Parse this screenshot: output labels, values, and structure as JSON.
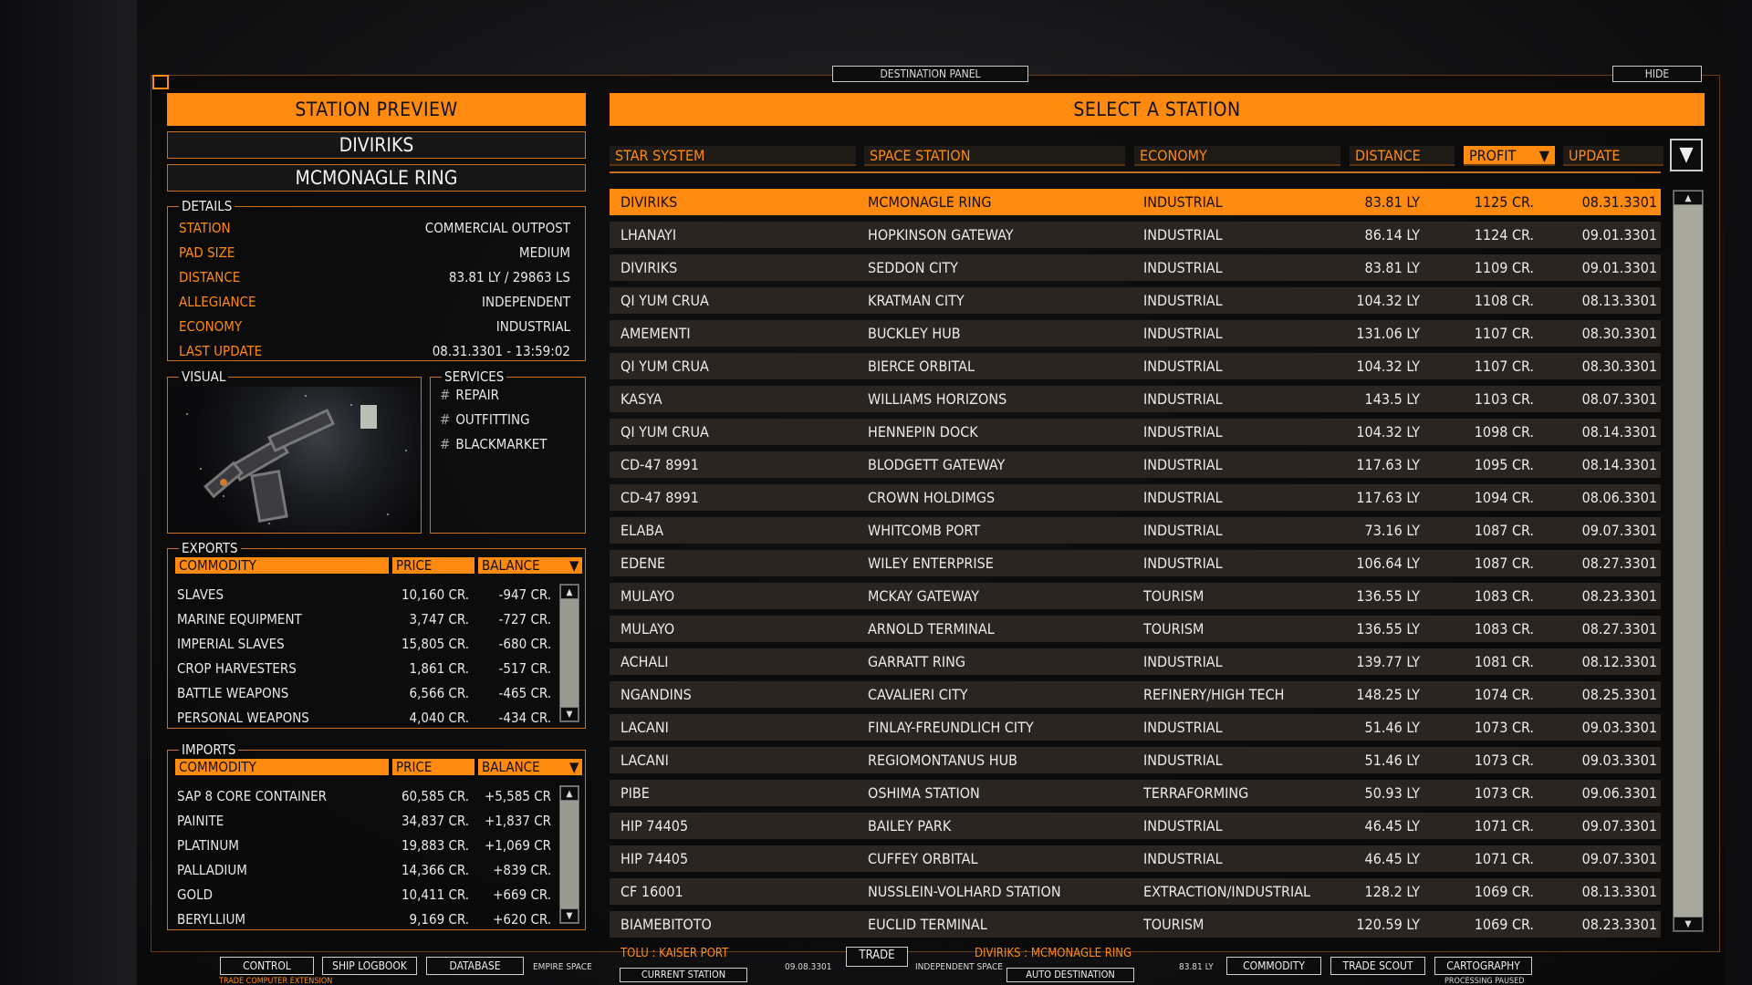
{
  "top": {
    "panel_label": "DESTINATION PANEL",
    "hide_label": "HIDE"
  },
  "preview": {
    "title": "STATION PREVIEW",
    "system": "DIVIRIKS",
    "station": "MCMONAGLE RING",
    "details_legend": "DETAILS",
    "details": [
      {
        "key": "STATION",
        "value": "COMMERCIAL OUTPOST"
      },
      {
        "key": "PAD SIZE",
        "value": "MEDIUM"
      },
      {
        "key": "DISTANCE",
        "value": "83.81 LY / 29863 LS"
      },
      {
        "key": "ALLEGIANCE",
        "value": "INDEPENDENT"
      },
      {
        "key": "ECONOMY",
        "value": "INDUSTRIAL"
      },
      {
        "key": "LAST UPDATE",
        "value": "08.31.3301 - 13:59:02"
      }
    ],
    "visual_legend": "VISUAL",
    "services_legend": "SERVICES",
    "services": [
      "REPAIR",
      "OUTFITTING",
      "BLACKMARKET"
    ],
    "service_bullet": "#"
  },
  "exports": {
    "legend": "EXPORTS",
    "headers": {
      "commodity": "COMMODITY",
      "price": "PRICE",
      "balance": "BALANCE"
    },
    "rows": [
      {
        "commodity": "SLAVES",
        "price": "10,160 CR.",
        "balance": "-947 CR."
      },
      {
        "commodity": "MARINE EQUIPMENT",
        "price": "3,747 CR.",
        "balance": "-727 CR."
      },
      {
        "commodity": "IMPERIAL SLAVES",
        "price": "15,805 CR.",
        "balance": "-680 CR."
      },
      {
        "commodity": "CROP HARVESTERS",
        "price": "1,861 CR.",
        "balance": "-517 CR."
      },
      {
        "commodity": "BATTLE WEAPONS",
        "price": "6,566 CR.",
        "balance": "-465 CR."
      },
      {
        "commodity": "PERSONAL WEAPONS",
        "price": "4,040 CR.",
        "balance": "-434 CR."
      }
    ]
  },
  "imports": {
    "legend": "IMPORTS",
    "headers": {
      "commodity": "COMMODITY",
      "price": "PRICE",
      "balance": "BALANCE"
    },
    "rows": [
      {
        "commodity": "SAP 8 CORE CONTAINER",
        "price": "60,585 CR.",
        "balance": "+5,585 CR"
      },
      {
        "commodity": "PAINITE",
        "price": "34,837 CR.",
        "balance": "+1,837 CR"
      },
      {
        "commodity": "PLATINUM",
        "price": "19,883 CR.",
        "balance": "+1,069 CR"
      },
      {
        "commodity": "PALLADIUM",
        "price": "14,366 CR.",
        "balance": "+839 CR."
      },
      {
        "commodity": "GOLD",
        "price": "10,411 CR.",
        "balance": "+669 CR."
      },
      {
        "commodity": "BERYLLIUM",
        "price": "9,169 CR.",
        "balance": "+620 CR."
      }
    ]
  },
  "stations": {
    "title": "SELECT A STATION",
    "headers": {
      "star_system": "STAR SYSTEM",
      "space_station": "SPACE STATION",
      "economy": "ECONOMY",
      "distance": "DISTANCE",
      "profit": "PROFIT",
      "update": "UPDATE"
    },
    "sorted_by": "profit",
    "selected_row": 0,
    "rows": [
      {
        "system": "DIVIRIKS",
        "station": "MCMONAGLE RING",
        "economy": "INDUSTRIAL",
        "distance": "83.81 LY",
        "profit": "1125 CR.",
        "update": "08.31.3301"
      },
      {
        "system": "LHANAYI",
        "station": "HOPKINSON GATEWAY",
        "economy": "INDUSTRIAL",
        "distance": "86.14 LY",
        "profit": "1124 CR.",
        "update": "09.01.3301"
      },
      {
        "system": "DIVIRIKS",
        "station": "SEDDON CITY",
        "economy": "INDUSTRIAL",
        "distance": "83.81 LY",
        "profit": "1109 CR.",
        "update": "09.01.3301"
      },
      {
        "system": "QI YUM CRUA",
        "station": "KRATMAN CITY",
        "economy": "INDUSTRIAL",
        "distance": "104.32 LY",
        "profit": "1108 CR.",
        "update": "08.13.3301"
      },
      {
        "system": "AMEMENTI",
        "station": "BUCKLEY HUB",
        "economy": "INDUSTRIAL",
        "distance": "131.06 LY",
        "profit": "1107 CR.",
        "update": "08.30.3301"
      },
      {
        "system": "QI YUM CRUA",
        "station": "BIERCE ORBITAL",
        "economy": "INDUSTRIAL",
        "distance": "104.32 LY",
        "profit": "1107 CR.",
        "update": "08.30.3301"
      },
      {
        "system": "KASYA",
        "station": "WILLIAMS HORIZONS",
        "economy": "INDUSTRIAL",
        "distance": "143.5 LY",
        "profit": "1103 CR.",
        "update": "08.07.3301"
      },
      {
        "system": "QI YUM CRUA",
        "station": "HENNEPIN DOCK",
        "economy": "INDUSTRIAL",
        "distance": "104.32 LY",
        "profit": "1098 CR.",
        "update": "08.14.3301"
      },
      {
        "system": "CD-47 8991",
        "station": "BLODGETT GATEWAY",
        "economy": "INDUSTRIAL",
        "distance": "117.63 LY",
        "profit": "1095 CR.",
        "update": "08.14.3301"
      },
      {
        "system": "CD-47 8991",
        "station": "CROWN HOLDIMGS",
        "economy": "INDUSTRIAL",
        "distance": "117.63 LY",
        "profit": "1094 CR.",
        "update": "08.06.3301"
      },
      {
        "system": "ELABA",
        "station": "WHITCOMB PORT",
        "economy": "INDUSTRIAL",
        "distance": "73.16 LY",
        "profit": "1087 CR.",
        "update": "09.07.3301"
      },
      {
        "system": "EDENE",
        "station": "WILEY ENTERPRISE",
        "economy": "INDUSTRIAL",
        "distance": "106.64 LY",
        "profit": "1087 CR.",
        "update": "08.27.3301"
      },
      {
        "system": "MULAYO",
        "station": "MCKAY GATEWAY",
        "economy": "TOURISM",
        "distance": "136.55 LY",
        "profit": "1083 CR.",
        "update": "08.23.3301"
      },
      {
        "system": "MULAYO",
        "station": "ARNOLD TERMINAL",
        "economy": "TOURISM",
        "distance": "136.55 LY",
        "profit": "1083 CR.",
        "update": "08.27.3301"
      },
      {
        "system": "ACHALI",
        "station": "GARRATT RING",
        "economy": "INDUSTRIAL",
        "distance": "139.77 LY",
        "profit": "1081 CR.",
        "update": "08.12.3301"
      },
      {
        "system": "NGANDINS",
        "station": "CAVALIERI CITY",
        "economy": "REFINERY/HIGH TECH",
        "distance": "148.25 LY",
        "profit": "1074 CR.",
        "update": "08.25.3301"
      },
      {
        "system": "LACANI",
        "station": "FINLAY-FREUNDLICH CITY",
        "economy": "INDUSTRIAL",
        "distance": "51.46 LY",
        "profit": "1073 CR.",
        "update": "09.03.3301"
      },
      {
        "system": "LACANI",
        "station": "REGIOMONTANUS HUB",
        "economy": "INDUSTRIAL",
        "distance": "51.46 LY",
        "profit": "1073 CR.",
        "update": "09.03.3301"
      },
      {
        "system": "PIBE",
        "station": "OSHIMA STATION",
        "economy": "TERRAFORMING",
        "distance": "50.93 LY",
        "profit": "1073 CR.",
        "update": "09.06.3301"
      },
      {
        "system": "HIP 74405",
        "station": "BAILEY PARK",
        "economy": "INDUSTRIAL",
        "distance": "46.45 LY",
        "profit": "1071 CR.",
        "update": "09.07.3301"
      },
      {
        "system": "HIP 74405",
        "station": "CUFFEY ORBITAL",
        "economy": "INDUSTRIAL",
        "distance": "46.45 LY",
        "profit": "1071 CR.",
        "update": "09.07.3301"
      },
      {
        "system": "CF 16001",
        "station": "NUSSLEIN-VOLHARD STATION",
        "economy": "EXTRACTION/INDUSTRIAL",
        "distance": "128.2 LY",
        "profit": "1069 CR.",
        "update": "08.13.3301"
      },
      {
        "system": "BIAMEBITOTO",
        "station": "EUCLID TERMINAL",
        "economy": "TOURISM",
        "distance": "120.59 LY",
        "profit": "1069 CR.",
        "update": "08.23.3301"
      }
    ]
  },
  "bottom_bar": {
    "control": "CONTROL",
    "ship_logbook": "SHIP LOGBOOK",
    "database": "DATABASE",
    "empire_space": "EMPIRE SPACE",
    "current_location": "TOLU : KAISER PORT",
    "current_date": "09.08.3301",
    "trade": "TRADE",
    "current_station": "CURRENT STATION",
    "independent_space": "INDEPENDENT SPACE",
    "destination_location": "DIVIRIKS : MCMONAGLE RING",
    "destination_distance": "83.81 LY",
    "auto_destination": "AUTO DESTINATION",
    "commodity": "COMMODITY",
    "trade_scout": "TRADE SCOUT",
    "cartography": "CARTOGRAPHY",
    "trade_computer": "TRADE COMPUTER EXTENSION",
    "processing_paused": "PROCESSING PAUSED"
  },
  "colors": {
    "accent": "#ff8a10",
    "row_bg": "#2a2520",
    "panel_bg": "#0b0b0b"
  }
}
